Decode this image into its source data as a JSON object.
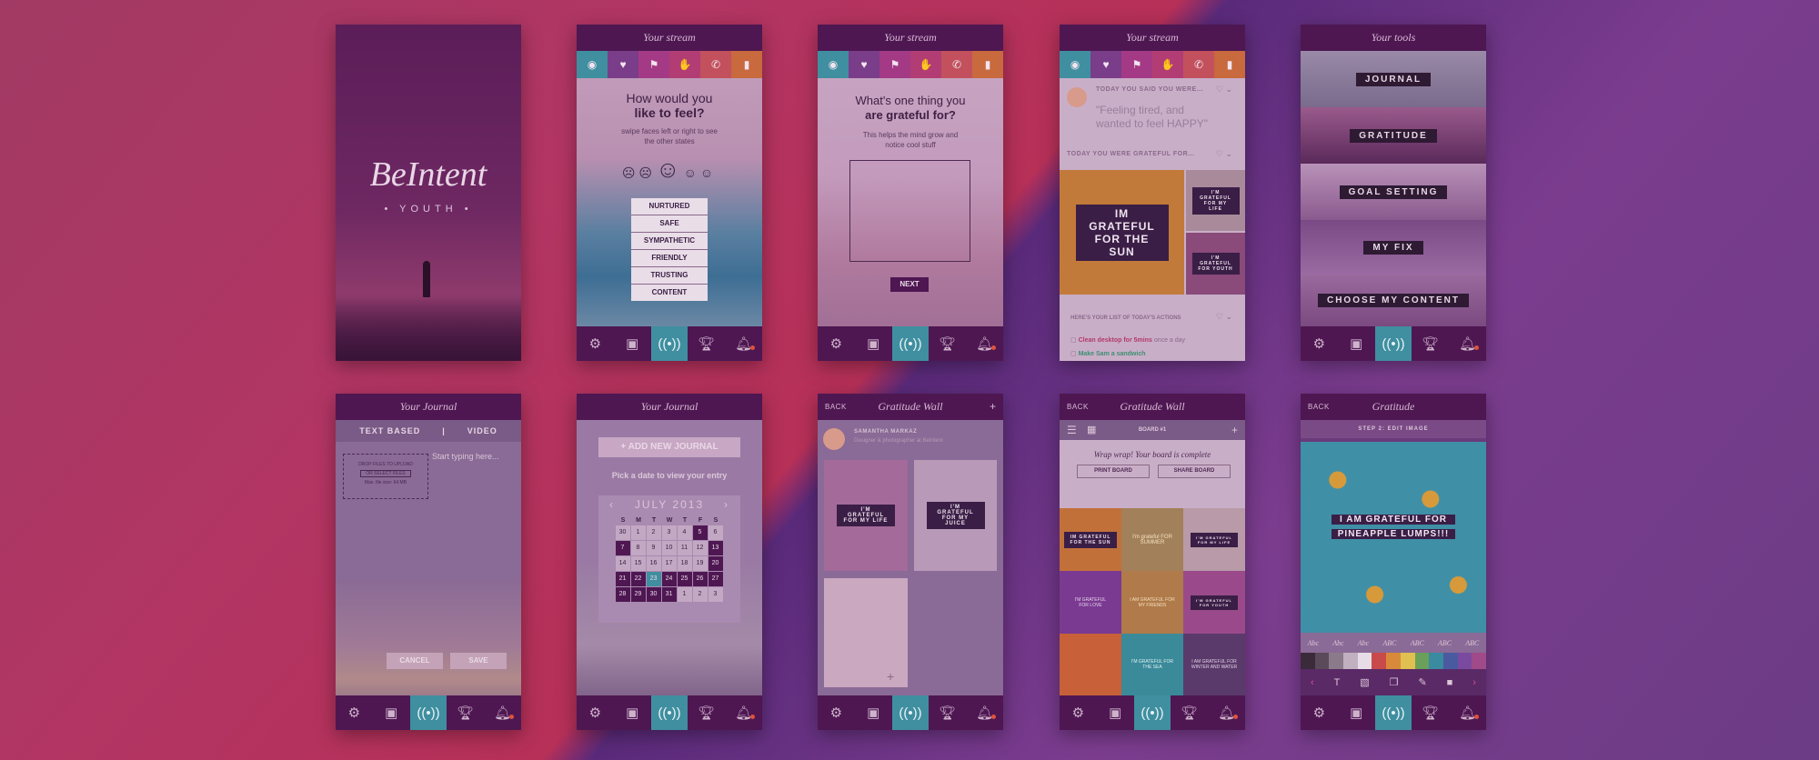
{
  "splash": {
    "logo": "BeIntent",
    "subtitle": "• YOUTH •"
  },
  "stream_feel": {
    "header": "Your stream",
    "question_line1": "How would you",
    "question_line2": "like to feel?",
    "hint": "swipe faces left or right to see the other states",
    "feelings": [
      "NURTURED",
      "SAFE",
      "SYMPATHETIC",
      "FRIENDLY",
      "TRUSTING",
      "CONTENT"
    ]
  },
  "stream_grateful": {
    "header": "Your stream",
    "question_line1": "What's one thing you",
    "question_line2": "are grateful for?",
    "hint": "This helps the mind grow and notice cool stuff",
    "next": "NEXT"
  },
  "stream_feed": {
    "header": "Your stream",
    "said_label": "TODAY YOU SAID YOU WERE...",
    "said_line1": "\"Feeling tired, and",
    "said_line2": "wanted to feel HAPPY\"",
    "grateful_label": "TODAY YOU WERE GRATEFUL FOR...",
    "grateful_card": "IM GRATEFUL FOR THE SUN",
    "small_card_1": "I'M GRATEFUL FOR MY LIFE",
    "small_card_2": "I'M GRATEFUL FOR YOUTH",
    "actions_label": "HERE'S YOUR LIST OF TODAY'S ACTIONS",
    "action_1": "Clean desktop for 5mins",
    "action_1_suffix": "once a day",
    "action_2": "Make Sam a sandwich"
  },
  "tools": {
    "header": "Your tools",
    "items": [
      "JOURNAL",
      "GRATITUDE",
      "GOAL SETTING",
      "MY FIX",
      "CHOOSE MY CONTENT"
    ]
  },
  "journal_text": {
    "header": "Your Journal",
    "tab_text": "TEXT BASED",
    "divider": "|",
    "tab_video": "VIDEO",
    "drop_line1": "DROP FILES TO UPLOAD",
    "drop_button": "OR SELECT FILES",
    "drop_line2": "Max. file size: 64 MB",
    "placeholder": "Start typing here...",
    "cancel": "CANCEL",
    "save": "SAVE"
  },
  "journal_calendar": {
    "header": "Your Journal",
    "add_button": "+ ADD NEW JOURNAL",
    "pick_text": "Pick a date to view your entry",
    "month": "JULY 2013",
    "prev": "‹",
    "next": "›",
    "weekdays": [
      "S",
      "M",
      "T",
      "W",
      "T",
      "F",
      "S"
    ],
    "days": [
      [
        "30",
        "1",
        "2",
        "3",
        "4",
        "5",
        "6"
      ],
      [
        "7",
        "8",
        "9",
        "10",
        "11",
        "12",
        "13"
      ],
      [
        "14",
        "15",
        "16",
        "17",
        "18",
        "19",
        "20"
      ],
      [
        "21",
        "22",
        "23",
        "24",
        "25",
        "26",
        "27"
      ],
      [
        "28",
        "29",
        "30",
        "31",
        "1",
        "2",
        "3"
      ]
    ]
  },
  "gratitude_wall_profile": {
    "header": "Gratitude Wall",
    "back": "BACK",
    "plus": "+",
    "user_name": "SAMANTHA MARKAZ",
    "user_role": "Designer & photographer at BeIntent",
    "card_1": "I'M GRATEFUL FOR MY LIFE",
    "card_2": "I'M GRATEFUL FOR MY JUICE"
  },
  "gratitude_wall_board": {
    "header": "Gratitude Wall",
    "back": "BACK",
    "board_name": "BOARD #1",
    "plus": "+",
    "complete_text": "Wrap wrap! Your board is complete",
    "print": "PRINT BOARD",
    "share": "SHARE BOARD",
    "cells": [
      "IM GRATEFUL FOR THE SUN",
      "I'm grateful FOR SUMMER",
      "I'M GRATEFUL FOR MY LIFE",
      "I'M GRATEFUL FOR LOVE",
      "I AM GRATEFUL FOR MY FRIENDS",
      "I'M GRATEFUL FOR YOUTH",
      "",
      "I'M GRATEFUL FOR THE SEA",
      "I AM GRATEFUL FOR WINTER AND WATER"
    ]
  },
  "gratitude_edit": {
    "header": "Gratitude",
    "back": "BACK",
    "step": "STEP 2: EDIT IMAGE",
    "caption_line1": "I AM GRATEFUL FOR",
    "caption_line2": "PINEAPPLE LUMPS!!!",
    "fonts": [
      "Abc",
      "Abc",
      "Abc",
      "ABC",
      "ABC",
      "ABC",
      "ABC"
    ],
    "swatches": [
      "#3a2a3a",
      "#5a4a5a",
      "#8a7a8a",
      "#c0b0c0",
      "#e6dde6",
      "#c84a4a",
      "#d88a3a",
      "#e0c050",
      "#6aa05a",
      "#3a8aa0",
      "#4a5aa0",
      "#7a4aa0",
      "#a04a8a"
    ]
  },
  "colors": {
    "header_bg": "#4e1752",
    "nav_active": "#3f8fa0",
    "tab_colors": [
      "#3f8fa0",
      "#7a3d8a",
      "#a43a86",
      "#b23d74",
      "#c2515d",
      "#c8693e"
    ]
  },
  "nav_icons": [
    "gear-icon",
    "briefcase-icon",
    "broadcast-icon",
    "trophy-icon",
    "bell-icon"
  ],
  "stream_tab_icons": [
    "head-icon",
    "heart-hand-icon",
    "flag-icon",
    "hand-icon",
    "phone-icon",
    "bookmark-icon"
  ]
}
